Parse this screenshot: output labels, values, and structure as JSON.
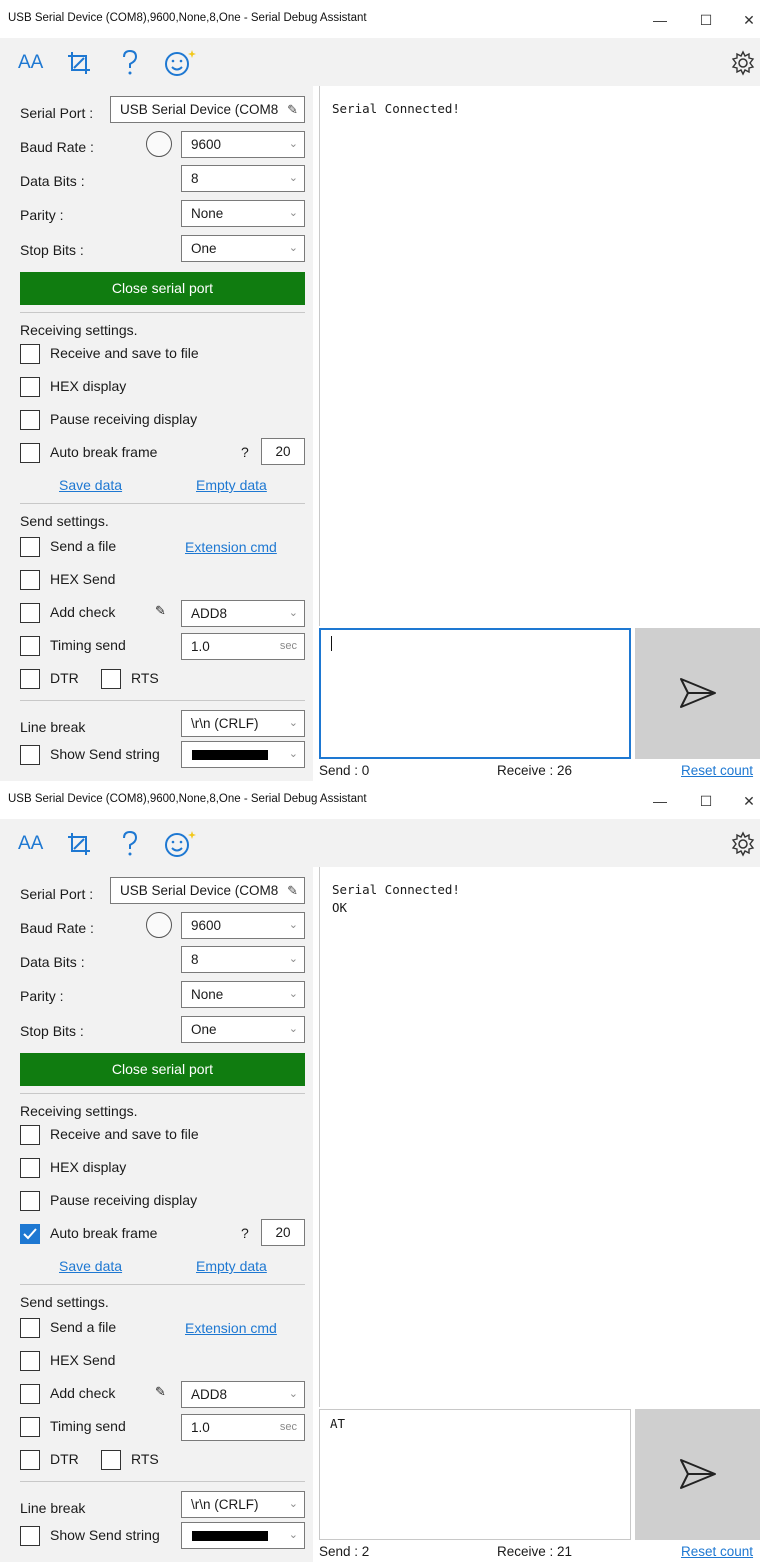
{
  "windows": [
    {
      "title": "USB Serial Device (COM8),9600,None,8,One - Serial Debug Assistant",
      "controls": {
        "minimize": "—",
        "maximize": "☐",
        "close": "✕"
      },
      "toolbar": {
        "font_icon_text": "AA"
      },
      "port": {
        "serial_port_label": "Serial Port :",
        "serial_port_value": "USB Serial Device (COM8",
        "baud_label": "Baud Rate :",
        "baud_value": "9600",
        "data_bits_label": "Data Bits :",
        "data_bits_value": "8",
        "parity_label": "Parity :",
        "parity_value": "None",
        "stop_bits_label": "Stop Bits :",
        "stop_bits_value": "One",
        "close_button": "Close serial port"
      },
      "receiving": {
        "heading": "Receiving settings.",
        "save_to_file": "Receive and save to file",
        "save_to_file_checked": false,
        "hex_display": "HEX display",
        "hex_display_checked": false,
        "pause": "Pause receiving display",
        "pause_checked": false,
        "auto_break": "Auto break frame",
        "auto_break_checked": false,
        "auto_break_help": "?",
        "auto_break_value": "20",
        "save_data": "Save data",
        "empty_data": "Empty data"
      },
      "sending": {
        "heading": "Send settings.",
        "send_file": "Send a file",
        "extension_cmd": "Extension cmd",
        "hex_send": "HEX Send",
        "add_check": "Add check",
        "check_value": "ADD8",
        "timing_send": "Timing send",
        "timing_value": "1.0",
        "timing_unit": "sec",
        "dtr": "DTR",
        "rts": "RTS",
        "line_break_label": "Line break",
        "line_break_value": "\\r\\n (CRLF)",
        "show_send_string": "Show Send string"
      },
      "receive_text": "Serial Connected!",
      "send_text": "",
      "status": {
        "send": "Send : 0",
        "receive": "Receive : 26",
        "reset": "Reset count"
      }
    },
    {
      "title": "USB Serial Device (COM8),9600,None,8,One - Serial Debug Assistant",
      "controls": {
        "minimize": "—",
        "maximize": "☐",
        "close": "✕"
      },
      "toolbar": {
        "font_icon_text": "AA"
      },
      "port": {
        "serial_port_label": "Serial Port :",
        "serial_port_value": "USB Serial Device (COM8",
        "baud_label": "Baud Rate :",
        "baud_value": "9600",
        "data_bits_label": "Data Bits :",
        "data_bits_value": "8",
        "parity_label": "Parity :",
        "parity_value": "None",
        "stop_bits_label": "Stop Bits :",
        "stop_bits_value": "One",
        "close_button": "Close serial port"
      },
      "receiving": {
        "heading": "Receiving settings.",
        "save_to_file": "Receive and save to file",
        "save_to_file_checked": false,
        "hex_display": "HEX display",
        "hex_display_checked": false,
        "pause": "Pause receiving display",
        "pause_checked": false,
        "auto_break": "Auto break frame",
        "auto_break_checked": true,
        "auto_break_help": "?",
        "auto_break_value": "20",
        "save_data": "Save data",
        "empty_data": "Empty data"
      },
      "sending": {
        "heading": "Send settings.",
        "send_file": "Send a file",
        "extension_cmd": "Extension cmd",
        "hex_send": "HEX Send",
        "add_check": "Add check",
        "check_value": "ADD8",
        "timing_send": "Timing send",
        "timing_value": "1.0",
        "timing_unit": "sec",
        "dtr": "DTR",
        "rts": "RTS",
        "line_break_label": "Line break",
        "line_break_value": "\\r\\n (CRLF)",
        "show_send_string": "Show Send string"
      },
      "receive_text": "Serial Connected!\nOK",
      "send_text": "AT",
      "status": {
        "send": "Send : 2",
        "receive": "Receive : 21",
        "reset": "Reset count"
      }
    }
  ],
  "colors": {
    "accent": "#1e78d2",
    "connect_button": "#107c10",
    "panel": "#f2f2f2",
    "send_button": "#cfcfcf"
  }
}
